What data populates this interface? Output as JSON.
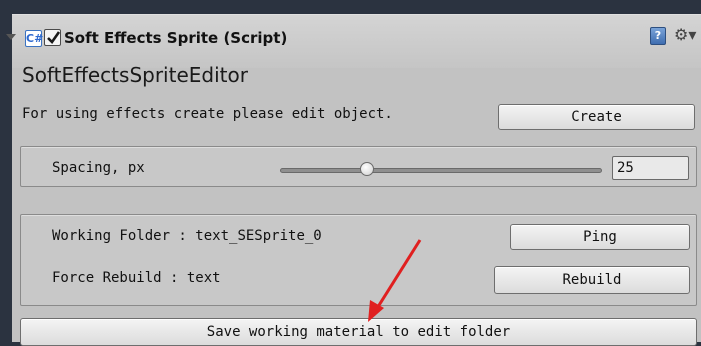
{
  "component": {
    "title": "Soft Effects Sprite (Script)",
    "enabled": true,
    "script_icon_glyph": "C#",
    "help_icon": "help-icon",
    "settings_icon": "gear-icon"
  },
  "editor": {
    "title": "SoftEffectsSpriteEditor",
    "info_text": "For using effects create please edit object.",
    "create_button": "Create"
  },
  "spacing": {
    "label": "Spacing, px",
    "value": "25",
    "slider_fraction": 0.27
  },
  "folder": {
    "working_folder_label": "Working Folder :",
    "working_folder_value": "text_SESprite_0",
    "ping_button": "Ping",
    "force_rebuild_label": "Force Rebuild :",
    "force_rebuild_value": "text",
    "rebuild_button": "Rebuild"
  },
  "save_button": "Save working material to edit folder",
  "colors": {
    "background": "#2b3340",
    "panel": "#c2c2c2",
    "annotation_arrow": "#e02020"
  }
}
